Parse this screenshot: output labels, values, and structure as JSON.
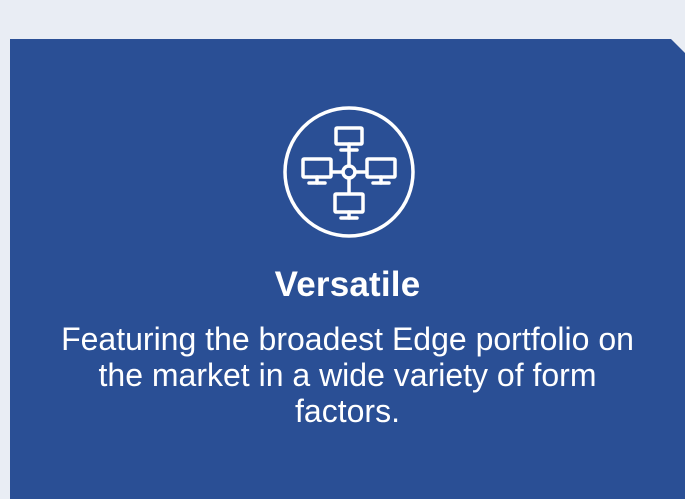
{
  "card": {
    "icon": "network-computers-icon",
    "title": "Versatile",
    "description": "Featuring the broadest Edge portfolio on the market in a wide variety of form factors.",
    "background_color": "#2a4f95",
    "text_color": "#ffffff"
  },
  "page": {
    "background_color": "#e9edf4"
  }
}
